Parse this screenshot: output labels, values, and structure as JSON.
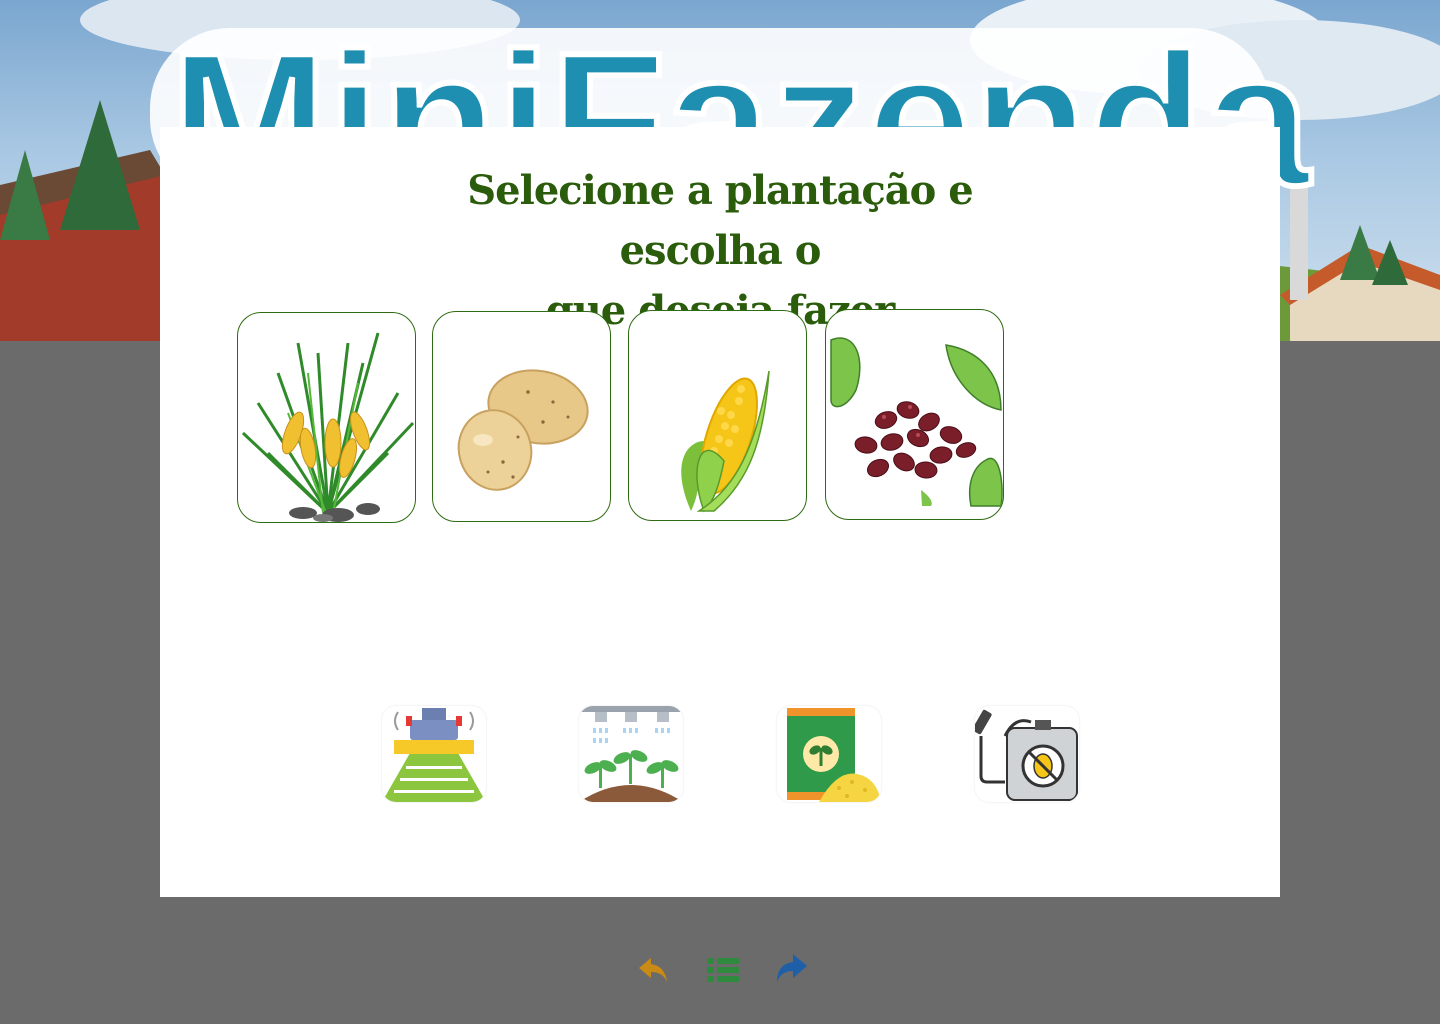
{
  "app": {
    "banner_logo_text": "MiniFazenda"
  },
  "modal": {
    "title_line1": "Selecione a plantação e escolha o",
    "title_line2": "que deseja fazer"
  },
  "crops": [
    {
      "name": "rice-crop",
      "icon": "rice-plant-icon"
    },
    {
      "name": "potato-crop",
      "icon": "potato-icon"
    },
    {
      "name": "corn-crop",
      "icon": "corn-icon"
    },
    {
      "name": "bean-crop",
      "icon": "bean-icon"
    }
  ],
  "actions": [
    {
      "name": "plant-action",
      "icon": "planter-machine-icon"
    },
    {
      "name": "irrigate-action",
      "icon": "irrigation-icon"
    },
    {
      "name": "fertilize-action",
      "icon": "fertilizer-bag-icon"
    },
    {
      "name": "pesticide-action",
      "icon": "pesticide-sprayer-icon"
    }
  ],
  "navigation": {
    "back_icon": "back-arrow-icon",
    "menu_icon": "list-menu-icon",
    "forward_icon": "forward-arrow-icon"
  },
  "colors": {
    "title_green": "#2a5c0c",
    "card_border": "#2e6b12",
    "back_arrow": "#c98a16",
    "menu_green": "#2e8b3e",
    "forward_arrow": "#1f5fa8",
    "overlay": "#6b6b6b"
  }
}
